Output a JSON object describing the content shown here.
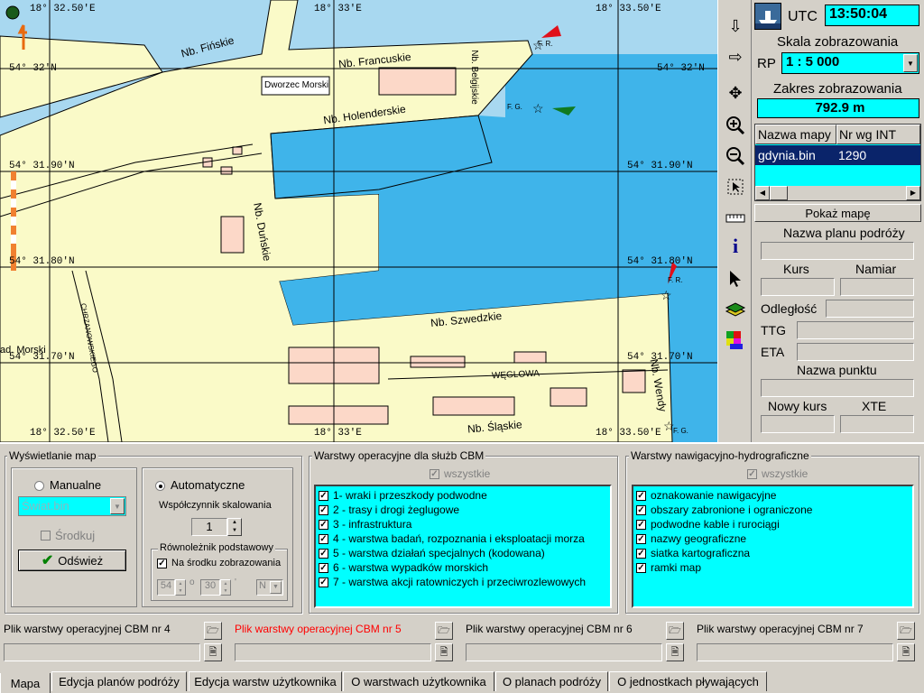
{
  "map": {
    "coords_top": [
      "18° 32.50'E",
      "18° 33'E",
      "18° 33.50'E"
    ],
    "coords_bottom": [
      "18° 32.50'E",
      "18° 33'E",
      "18° 33.50'E"
    ],
    "coords_left": [
      "54° 32'N",
      "54° 31.90'N",
      "54° 31.80'N",
      "54° 31.70'N"
    ],
    "coords_right": [
      "54° 32'N",
      "54° 31.90'N",
      "54° 31.80'N",
      "54° 31.70'N"
    ],
    "labels": {
      "nb_finskie": "Nb. Fińskie",
      "nb_francuskie": "Nb. Francuskie",
      "nb_belgijskie": "Nb. Belgijskie",
      "dworzec_morski": "Dworzec Morski",
      "nb_holenderskie": "Nb. Holenderskie",
      "nb_dunskie": "Nb. Duńskie",
      "nb_szwedzkie": "Nb. Szwedzkie",
      "weglowa": "WĘGLOWA",
      "nb_wendy": "Nb. Wendy",
      "nb_slaskie": "Nb. Śląskie",
      "chrzanowskiego": "CHRZANOWSKIEGO",
      "ad_morski": "ad. Morski",
      "fr1": "F. R.",
      "fg1": "F. G.",
      "fr2": "F. R.",
      "fg2": "F. G."
    },
    "colors": {
      "water": "#a8d8f0",
      "land": "#fafac8",
      "sea": "#3fb4ea",
      "grid": "#000000"
    }
  },
  "toolbar": {
    "icons": [
      "arrow-down-icon",
      "arrow-right-icon",
      "pan-icon",
      "zoom-in-icon",
      "zoom-out-icon",
      "select-area-icon",
      "ruler-icon",
      "info-icon",
      "pointer-icon",
      "layers-icon",
      "palette-icon"
    ]
  },
  "right": {
    "utc_label": "UTC",
    "utc_value": "13:50:04",
    "scale_title": "Skala zobrazowania",
    "rp_label": "RP",
    "scale_value": "1 : 5 000",
    "range_title": "Zakres zobrazowania",
    "range_value": "792.9 m",
    "maps_table": {
      "headers": [
        "Nazwa mapy",
        "Nr wg INT"
      ],
      "rows": [
        [
          "gdynia.bin",
          "1290"
        ]
      ]
    },
    "show_map_button": "Pokaż mapę",
    "plan_name_label": "Nazwa planu podróży",
    "course_label": "Kurs",
    "bearing_label": "Namiar",
    "distance_label": "Odległość",
    "ttg_label": "TTG",
    "eta_label": "ETA",
    "point_name_label": "Nazwa punktu",
    "new_course_label": "Nowy kurs",
    "xte_label": "XTE"
  },
  "display": {
    "title": "Wyświetlanie map",
    "manual_label": "Manualne",
    "auto_label": "Automatyczne",
    "map_select_value": "Świat.bin",
    "center_label": "Środkuj",
    "refresh_button": "Odśwież",
    "scale_factor_label": "Współczynnik skalowania",
    "scale_factor_value": "1",
    "parallel_title": "Równoleżnik podstawowy",
    "center_display_label": "Na środku zobrazowania",
    "deg_value": "54",
    "min_value": "30",
    "hemisphere_value": "N"
  },
  "cbm": {
    "title": "Warstwy operacyjne dla służb CBM",
    "all_label": "wszystkie",
    "items": [
      "1- wraki i przeszkody podwodne",
      "2 - trasy i drogi żeglugowe",
      "3 - infrastruktura",
      "4 - warstwa badań, rozpoznania i eksploatacji morza",
      "5 - warstwa działań specjalnych (kodowana)",
      "6 - warstwa wypadków morskich",
      "7 - warstwa akcji ratowniczych i przeciwrozlewowych"
    ]
  },
  "nav": {
    "title": "Warstwy nawigacyjno-hydrograficzne",
    "all_label": "wszystkie",
    "items": [
      "oznakowanie nawigacyjne",
      "obszary zabronione i ograniczone",
      "podwodne kable i rurociągi",
      "nazwy geograficzne",
      "siatka kartograficzna",
      "ramki map"
    ]
  },
  "files": [
    {
      "label": "Plik warstwy operacyjnej CBM nr 4",
      "color": "#000000"
    },
    {
      "label": "Plik warstwy operacyjnej CBM nr 5",
      "color": "#ff0000"
    },
    {
      "label": "Plik warstwy operacyjnej CBM nr 6",
      "color": "#000000"
    },
    {
      "label": "Plik warstwy operacyjnej CBM nr 7",
      "color": "#000000"
    }
  ],
  "tabs": [
    "Mapa",
    "Edycja planów podróży",
    "Edycja warstw użytkownika",
    "O  warstwach  użytkownika",
    "O planach  podróży",
    "O jednostkach pływających"
  ]
}
